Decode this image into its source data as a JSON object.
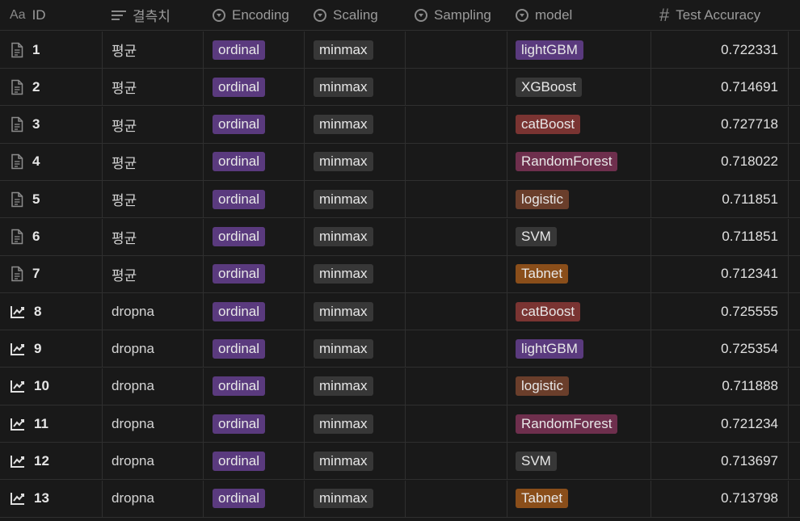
{
  "headers": {
    "id": "ID",
    "missing": "결측치",
    "encoding": "Encoding",
    "scaling": "Scaling",
    "sampling": "Sampling",
    "model": "model",
    "accuracy": "Test Accuracy",
    "id_icon_text": "Aa"
  },
  "tag_colors": {
    "ordinal": "#5a3a7e",
    "minmax": "#373737",
    "lightGBM": "#5a3a7e",
    "XGBoost": "#373737",
    "catBoost": "#7a3432",
    "RandomForest": "#6e2f4d",
    "logistic": "#6a3e2b",
    "SVM": "#373737",
    "Tabnet": "#8a4e1a"
  },
  "rows": [
    {
      "id": "1",
      "icon": "page-icon",
      "missing": "평균",
      "encoding": "ordinal",
      "scaling": "minmax",
      "sampling": "",
      "model": "lightGBM",
      "accuracy": "0.722331"
    },
    {
      "id": "2",
      "icon": "page-icon",
      "missing": "평균",
      "encoding": "ordinal",
      "scaling": "minmax",
      "sampling": "",
      "model": "XGBoost",
      "accuracy": "0.714691"
    },
    {
      "id": "3",
      "icon": "page-icon",
      "missing": "평균",
      "encoding": "ordinal",
      "scaling": "minmax",
      "sampling": "",
      "model": "catBoost",
      "accuracy": "0.727718"
    },
    {
      "id": "4",
      "icon": "page-icon",
      "missing": "평균",
      "encoding": "ordinal",
      "scaling": "minmax",
      "sampling": "",
      "model": "RandomForest",
      "accuracy": "0.718022"
    },
    {
      "id": "5",
      "icon": "page-icon",
      "missing": "평균",
      "encoding": "ordinal",
      "scaling": "minmax",
      "sampling": "",
      "model": "logistic",
      "accuracy": "0.711851"
    },
    {
      "id": "6",
      "icon": "page-icon",
      "missing": "평균",
      "encoding": "ordinal",
      "scaling": "minmax",
      "sampling": "",
      "model": "SVM",
      "accuracy": "0.711851"
    },
    {
      "id": "7",
      "icon": "page-icon",
      "missing": "평균",
      "encoding": "ordinal",
      "scaling": "minmax",
      "sampling": "",
      "model": "Tabnet",
      "accuracy": "0.712341"
    },
    {
      "id": "8",
      "icon": "trend-icon",
      "missing": "dropna",
      "encoding": "ordinal",
      "scaling": "minmax",
      "sampling": "",
      "model": "catBoost",
      "accuracy": "0.725555"
    },
    {
      "id": "9",
      "icon": "trend-icon",
      "missing": "dropna",
      "encoding": "ordinal",
      "scaling": "minmax",
      "sampling": "",
      "model": "lightGBM",
      "accuracy": "0.725354"
    },
    {
      "id": "10",
      "icon": "trend-icon",
      "missing": "dropna",
      "encoding": "ordinal",
      "scaling": "minmax",
      "sampling": "",
      "model": "logistic",
      "accuracy": "0.711888"
    },
    {
      "id": "11",
      "icon": "trend-icon",
      "missing": "dropna",
      "encoding": "ordinal",
      "scaling": "minmax",
      "sampling": "",
      "model": "RandomForest",
      "accuracy": "0.721234"
    },
    {
      "id": "12",
      "icon": "trend-icon",
      "missing": "dropna",
      "encoding": "ordinal",
      "scaling": "minmax",
      "sampling": "",
      "model": "SVM",
      "accuracy": "0.713697"
    },
    {
      "id": "13",
      "icon": "trend-icon",
      "missing": "dropna",
      "encoding": "ordinal",
      "scaling": "minmax",
      "sampling": "",
      "model": "Tabnet",
      "accuracy": "0.713798"
    }
  ]
}
